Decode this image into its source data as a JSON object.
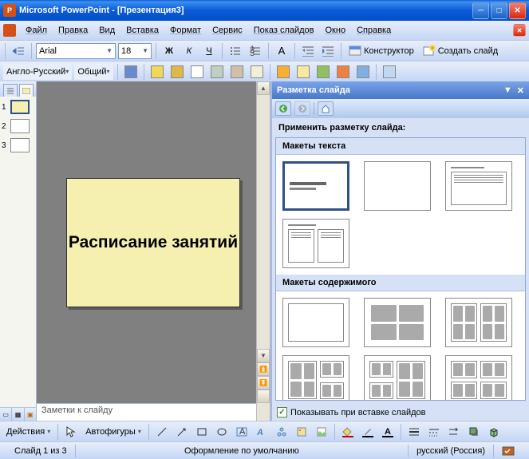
{
  "title": "Microsoft PowerPoint - [Презентация3]",
  "menu": {
    "file": "Файл",
    "edit": "Правка",
    "view": "Вид",
    "insert": "Вставка",
    "format": "Формат",
    "tools": "Сервис",
    "slideshow": "Показ слайдов",
    "window": "Окно",
    "help": "Справка"
  },
  "toolbar": {
    "font": "Arial",
    "size": "18",
    "bold": "Ж",
    "italic": "К",
    "underline": "Ч",
    "designer": "Конструктор",
    "new_slide": "Создать слайд"
  },
  "lang_bar": {
    "pair": "Англо-Русский",
    "mode": "Общий"
  },
  "thumbs": [
    {
      "n": "1"
    },
    {
      "n": "2"
    },
    {
      "n": "3"
    }
  ],
  "slide": {
    "title": "Расписание занятий"
  },
  "notes": {
    "placeholder": "Заметки к слайду"
  },
  "taskpane": {
    "title": "Разметка слайда",
    "apply_label": "Применить разметку слайда:",
    "sec_text": "Макеты текста",
    "sec_content": "Макеты содержимого",
    "show_on_insert": "Показывать при вставке слайдов"
  },
  "draw": {
    "actions": "Действия",
    "autoshapes": "Автофигуры"
  },
  "status": {
    "slide": "Слайд 1 из 3",
    "design": "Оформление по умолчанию",
    "lang": "русский (Россия)"
  }
}
